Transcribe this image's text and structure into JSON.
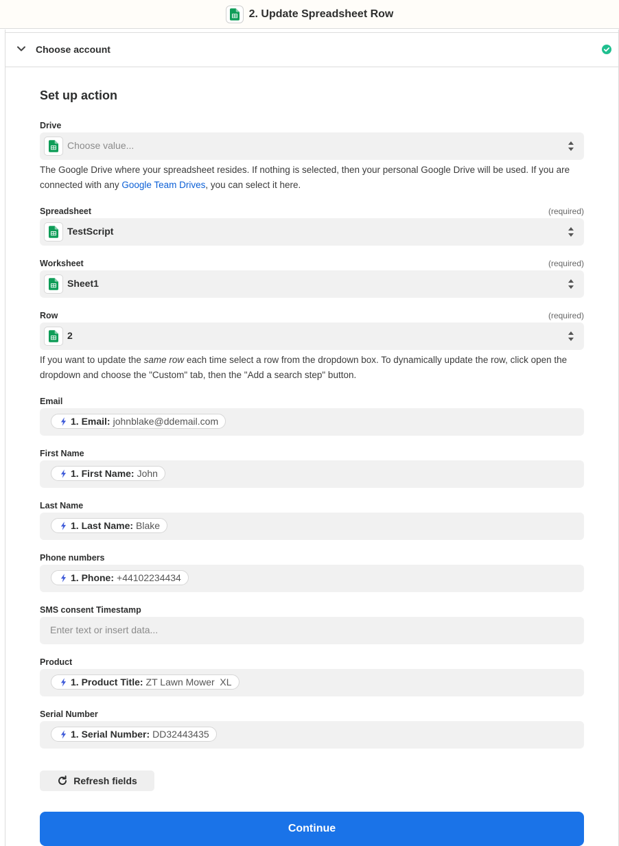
{
  "header": {
    "title": "2. Update Spreadsheet Row",
    "app_icon": "google-sheets-icon"
  },
  "section": {
    "title": "Choose account",
    "status": "complete",
    "status_icon": "check-circle-icon"
  },
  "setup": {
    "title": "Set up action",
    "drive": {
      "label": "Drive",
      "placeholder": "Choose value...",
      "help_before": "The Google Drive where your spreadsheet resides. If nothing is selected, then your personal Google Drive will be used. If you are connected with any ",
      "help_link": "Google Team Drives",
      "help_after": ", you can select it here."
    },
    "spreadsheet": {
      "label": "Spreadsheet",
      "required": "(required)",
      "value": "TestScript"
    },
    "worksheet": {
      "label": "Worksheet",
      "required": "(required)",
      "value": "Sheet1"
    },
    "row": {
      "label": "Row",
      "required": "(required)",
      "value": "2",
      "help_before": "If you want to update the ",
      "help_em": "same row",
      "help_after": " each time select a row from the dropdown box. To dynamically update the row, click open the dropdown and choose the \"Custom\" tab, then the \"Add a search step\" button."
    },
    "fields": {
      "email": {
        "label": "Email",
        "key": "1. Email:",
        "value": "johnblake@ddemail.com"
      },
      "first_name": {
        "label": "First Name",
        "key": "1. First Name:",
        "value": "John"
      },
      "last_name": {
        "label": "Last Name",
        "key": "1. Last Name:",
        "value": "Blake"
      },
      "phone": {
        "label": "Phone numbers",
        "key": "1. Phone:",
        "value": "+44102234434"
      },
      "sms": {
        "label": "SMS consent Timestamp",
        "placeholder": "Enter text or insert data..."
      },
      "product": {
        "label": "Product",
        "key": "1. Product Title:",
        "value": "ZT Lawn Mower  XL"
      },
      "serial": {
        "label": "Serial Number",
        "key": "1. Serial Number:",
        "value": "DD32443435"
      }
    }
  },
  "actions": {
    "refresh_label": "Refresh fields",
    "continue_label": "Continue"
  },
  "colors": {
    "accent": "#1a73e8",
    "sheets_green": "#0f9d58",
    "link": "#0b5fd6",
    "success": "#1fbf8f",
    "bolt": "#3f5bd9"
  }
}
